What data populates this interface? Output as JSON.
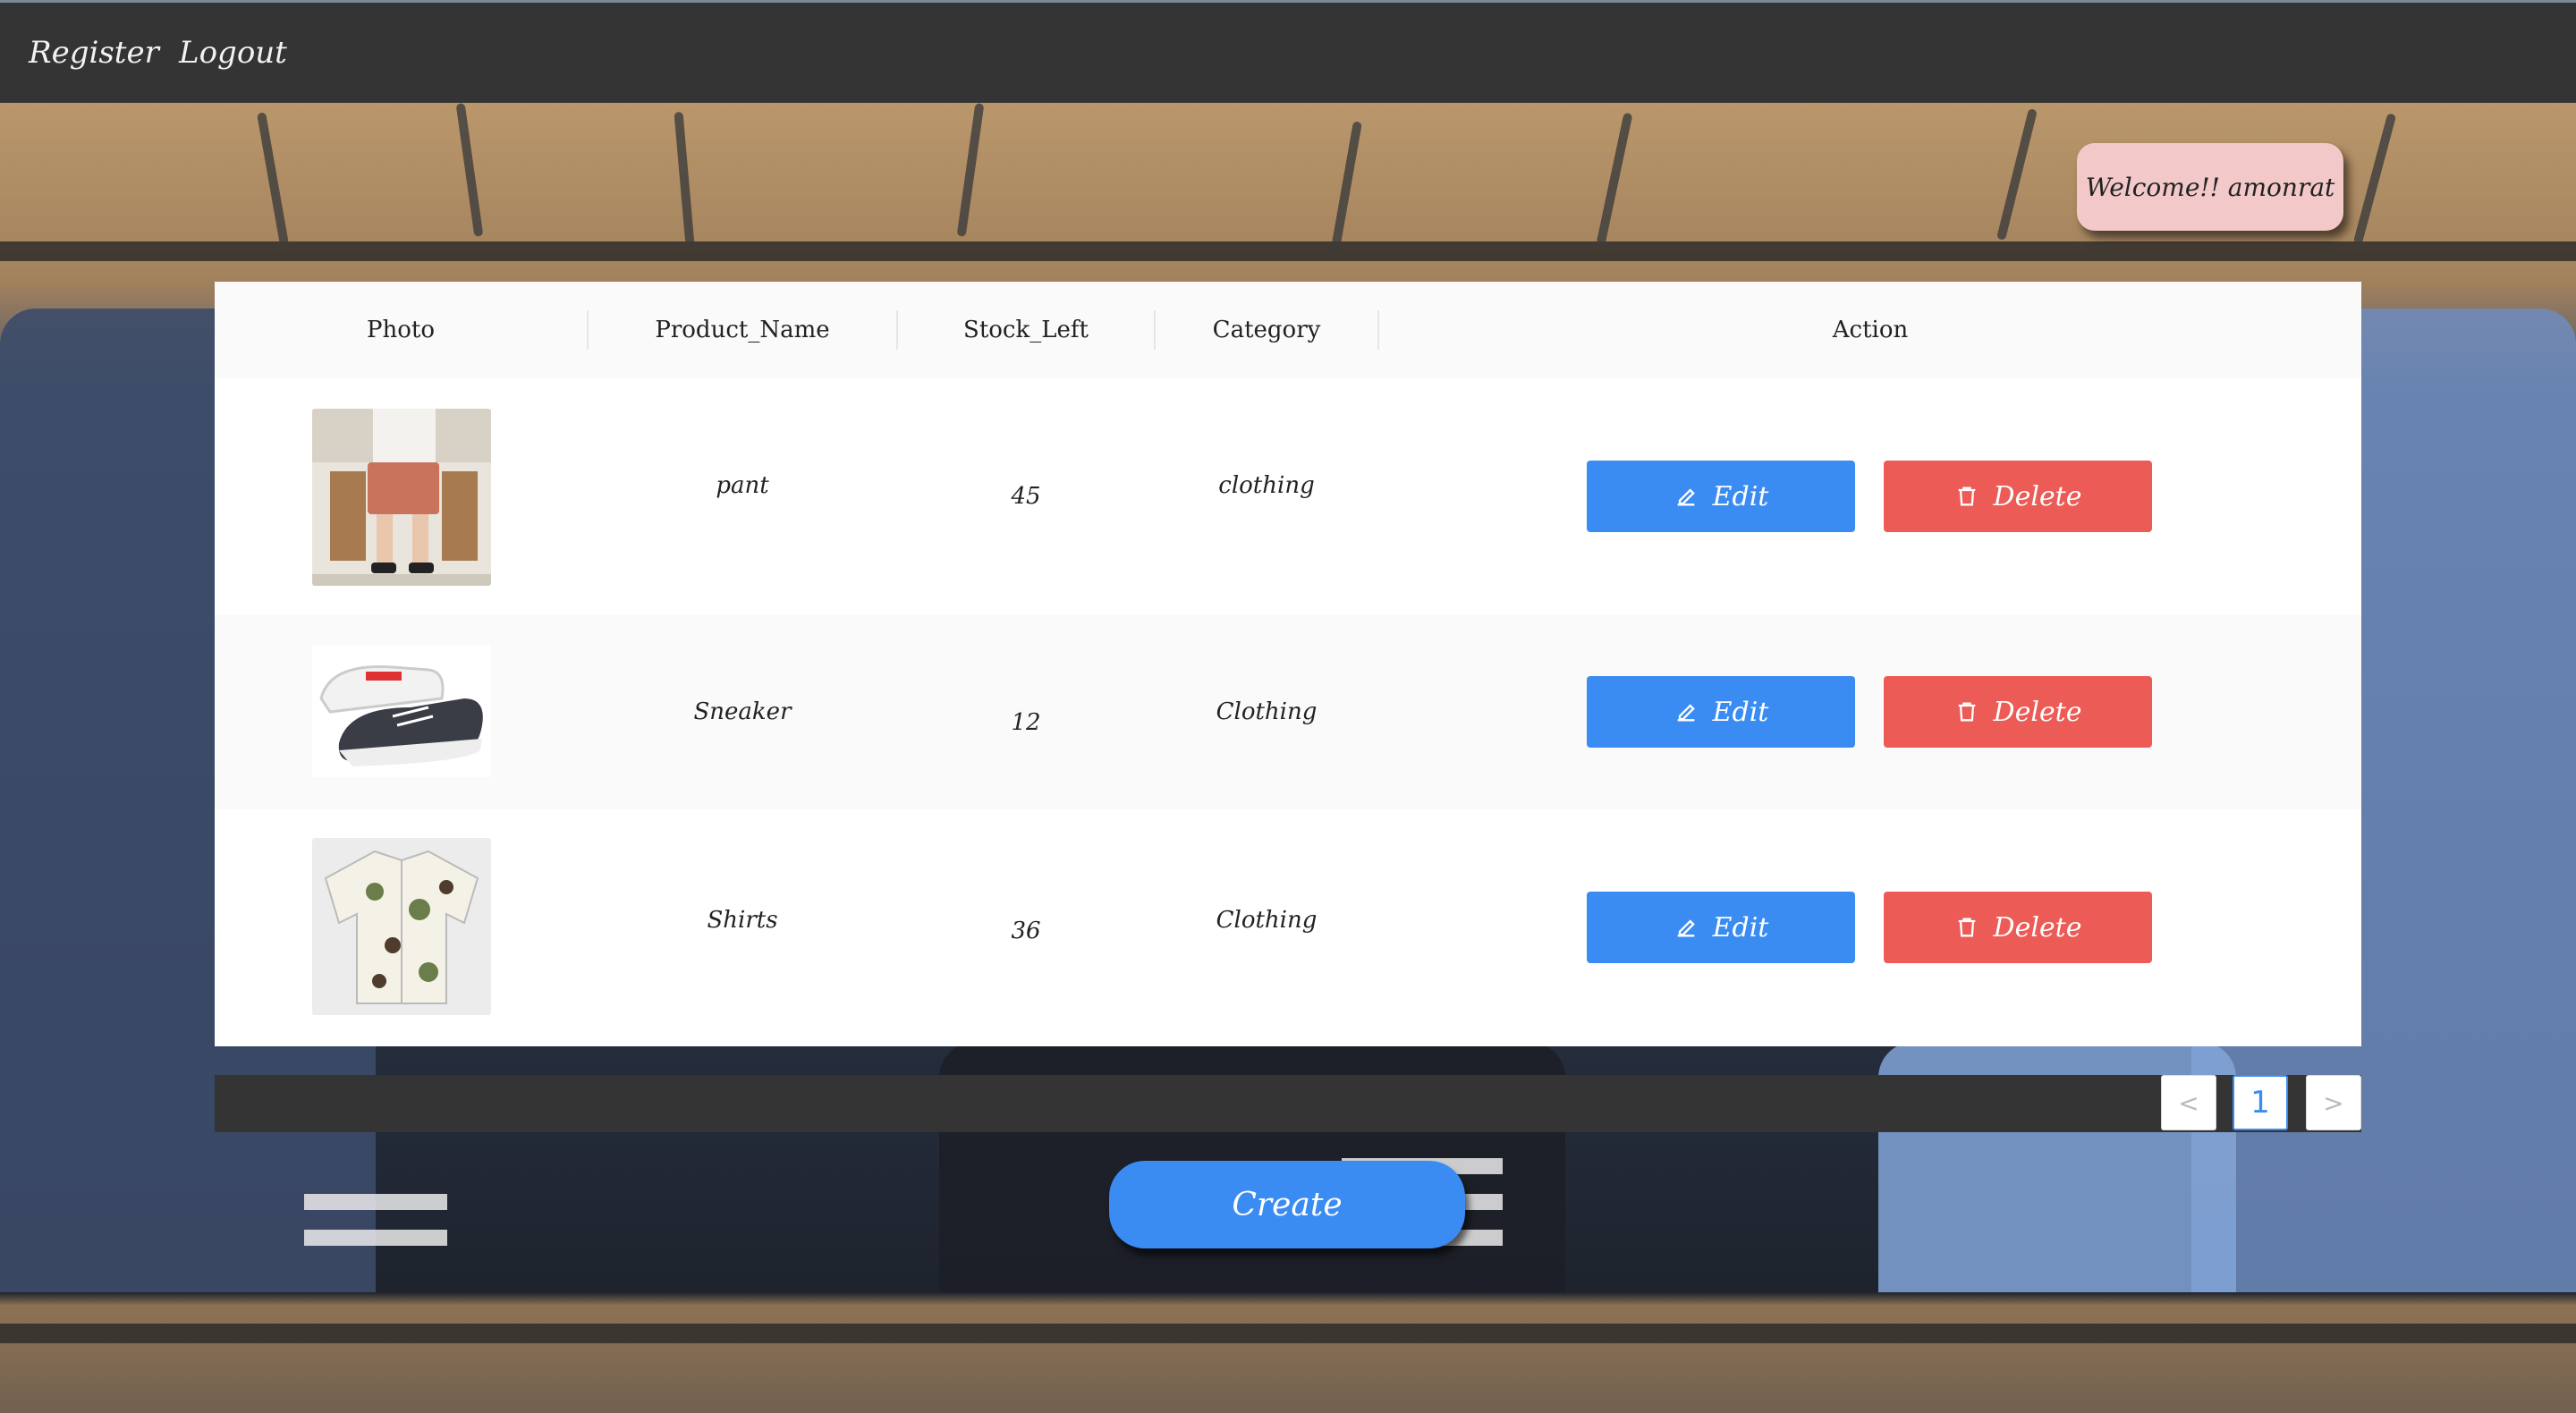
{
  "nav": {
    "register": "Register",
    "logout": "Logout"
  },
  "welcome": "Welcome!! amonrat",
  "table": {
    "headers": [
      "Photo",
      "Product_Name",
      "Stock_Left",
      "Category",
      "Action"
    ],
    "rows": [
      {
        "name": "pant",
        "stock": "45",
        "category": "clothing",
        "photo_icon": "shorts-photo"
      },
      {
        "name": "Sneaker",
        "stock": "12",
        "category": "Clothing",
        "photo_icon": "sneaker-photo"
      },
      {
        "name": "Shirts",
        "stock": "36",
        "category": "Clothing",
        "photo_icon": "shirt-photo"
      }
    ],
    "edit_label": "Edit",
    "delete_label": "Delete"
  },
  "pagination": {
    "prev": "<",
    "current": "1",
    "next": ">"
  },
  "create_label": "Create",
  "colors": {
    "primary": "#3a8cf2",
    "danger": "#ec5b56",
    "nav": "#343434",
    "welcome": "#f3c8c9"
  }
}
